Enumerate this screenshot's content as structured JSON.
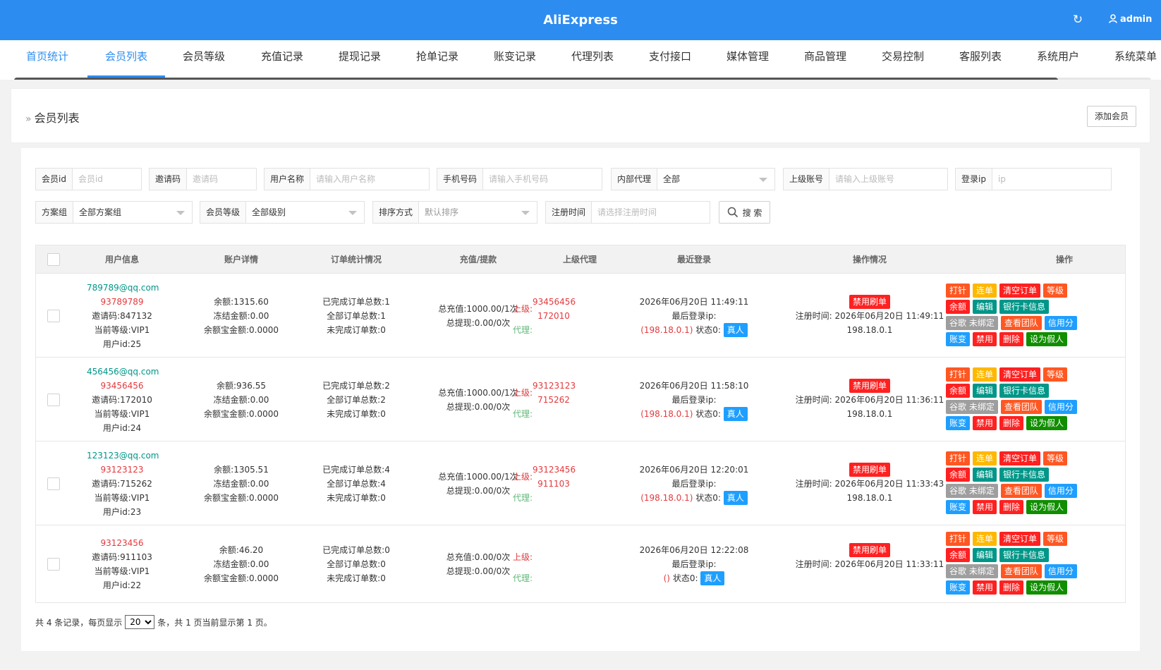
{
  "app": {
    "title": "AliExpress",
    "user": "admin"
  },
  "nav": {
    "tabs": [
      {
        "label": "首页统计"
      },
      {
        "label": "会员列表"
      },
      {
        "label": "会员等级"
      },
      {
        "label": "充值记录"
      },
      {
        "label": "提现记录"
      },
      {
        "label": "抢单记录"
      },
      {
        "label": "账变记录"
      },
      {
        "label": "代理列表"
      },
      {
        "label": "支付接口"
      },
      {
        "label": "媒体管理"
      },
      {
        "label": "商品管理"
      },
      {
        "label": "交易控制"
      },
      {
        "label": "客服列表"
      },
      {
        "label": "系统用户"
      },
      {
        "label": "系统菜单"
      }
    ],
    "active_index": 1
  },
  "page": {
    "title": "会员列表",
    "add_button": "添加会员"
  },
  "filters": {
    "member_id": {
      "label": "会员id",
      "placeholder": "会员id"
    },
    "invite_code": {
      "label": "邀请码",
      "placeholder": "邀请码"
    },
    "username": {
      "label": "用户名称",
      "placeholder": "请输入用户名称"
    },
    "phone": {
      "label": "手机号码",
      "placeholder": "请输入手机号码"
    },
    "internal_agent": {
      "label": "内部代理",
      "value": "全部"
    },
    "parent_account": {
      "label": "上级账号",
      "placeholder": "请输入上级账号"
    },
    "login_ip": {
      "label": "登录ip",
      "placeholder": "ip"
    },
    "plan_group": {
      "label": "方案组",
      "value": "全部方案组"
    },
    "member_level": {
      "label": "会员等级",
      "value": "全部级别"
    },
    "sort": {
      "label": "排序方式",
      "value": "默认排序"
    },
    "reg_time": {
      "label": "注册时间",
      "placeholder": "请选择注册时间"
    },
    "search_button": "搜 索"
  },
  "table": {
    "headers": [
      "用户信息",
      "账户详情",
      "订单统计情况",
      "充值/提款",
      "上级代理",
      "最近登录",
      "操作情况",
      "操作"
    ],
    "ops_buttons": {
      "line1": [
        "打针",
        "连单",
        "清空订单",
        "等级"
      ],
      "line2": [
        "余额",
        "编辑",
        "银行卡信息"
      ],
      "line3": [
        "谷歌 未绑定",
        "查看团队",
        "信用分"
      ],
      "line4": [
        "账变",
        "禁用",
        "删除",
        "设为假人"
      ]
    },
    "status_button": "禁用刷单",
    "real_badge": "真人",
    "labels": {
      "up": "上级:",
      "agent": "代理:",
      "last_login_ip": "最后登录ip:",
      "state": "状态0:",
      "reg_time_prefix": "注册时间:"
    },
    "rows": [
      {
        "email": "789789@qq.com",
        "phone": "93789789",
        "invite": "邀请码:847132",
        "level": "当前等级:VIP1",
        "uid": "用户id:25",
        "balance": "余额:1315.60",
        "frozen": "冻结金额:0.00",
        "yeb": "余额宝金额:0.0000",
        "done": "已完成订单总数:1",
        "all": "全部订单总数:1",
        "undone": "未完成订单数:0",
        "recharge": "总充值:1000.00/1次",
        "withdraw": "总提现:0.00/0次",
        "up_phone": "93456456",
        "up_code": "172010",
        "login_time": "2026年06月20日 11:49:11",
        "login_ip": "(198.18.0.1)",
        "reg_time": "2026年06月20日 11:49:11",
        "reg_ip": "198.18.0.1"
      },
      {
        "email": "456456@qq.com",
        "phone": "93456456",
        "invite": "邀请码:172010",
        "level": "当前等级:VIP1",
        "uid": "用户id:24",
        "balance": "余额:936.55",
        "frozen": "冻结金额:0.00",
        "yeb": "余额宝金额:0.0000",
        "done": "已完成订单总数:2",
        "all": "全部订单总数:2",
        "undone": "未完成订单数:0",
        "recharge": "总充值:1000.00/1次",
        "withdraw": "总提现:0.00/0次",
        "up_phone": "93123123",
        "up_code": "715262",
        "login_time": "2026年06月20日 11:58:10",
        "login_ip": "(198.18.0.1)",
        "reg_time": "2026年06月20日 11:36:11",
        "reg_ip": "198.18.0.1"
      },
      {
        "email": "123123@qq.com",
        "phone": "93123123",
        "invite": "邀请码:715262",
        "level": "当前等级:VIP1",
        "uid": "用户id:23",
        "balance": "余额:1305.51",
        "frozen": "冻结金额:0.00",
        "yeb": "余额宝金额:0.0000",
        "done": "已完成订单总数:4",
        "all": "全部订单总数:4",
        "undone": "未完成订单数:0",
        "recharge": "总充值:1000.00/1次",
        "withdraw": "总提现:0.00/0次",
        "up_phone": "93123456",
        "up_code": "911103",
        "login_time": "2026年06月20日 12:20:01",
        "login_ip": "(198.18.0.1)",
        "reg_time": "2026年06月20日 11:33:43",
        "reg_ip": "198.18.0.1"
      },
      {
        "email": "",
        "phone": "93123456",
        "invite": "邀请码:911103",
        "level": "当前等级:VIP1",
        "uid": "用户id:22",
        "balance": "余额:46.20",
        "frozen": "冻结金额:0.00",
        "yeb": "余额宝金额:0.0000",
        "done": "已完成订单总数:0",
        "all": "全部订单总数:0",
        "undone": "未完成订单数:0",
        "recharge": "总充值:0.00/0次",
        "withdraw": "总提现:0.00/0次",
        "up_phone": "",
        "up_code": "",
        "login_time": "2026年06月20日 12:22:08",
        "login_ip": "()",
        "reg_time": "2026年06月20日 11:33:11",
        "reg_ip": ""
      }
    ]
  },
  "pagination": {
    "prefix": "共 4 条记录，每页显示",
    "page_size": "20",
    "suffix": "条，共 1 页当前显示第 1 页。"
  },
  "colors": {
    "primary": "#2d8cf0",
    "red": "#ff2020",
    "orange": "#ff5722",
    "yellow": "#ffb800",
    "teal": "#009688",
    "gray": "#9e9e9e",
    "blue": "#1e9fff",
    "green": "#108e00"
  }
}
